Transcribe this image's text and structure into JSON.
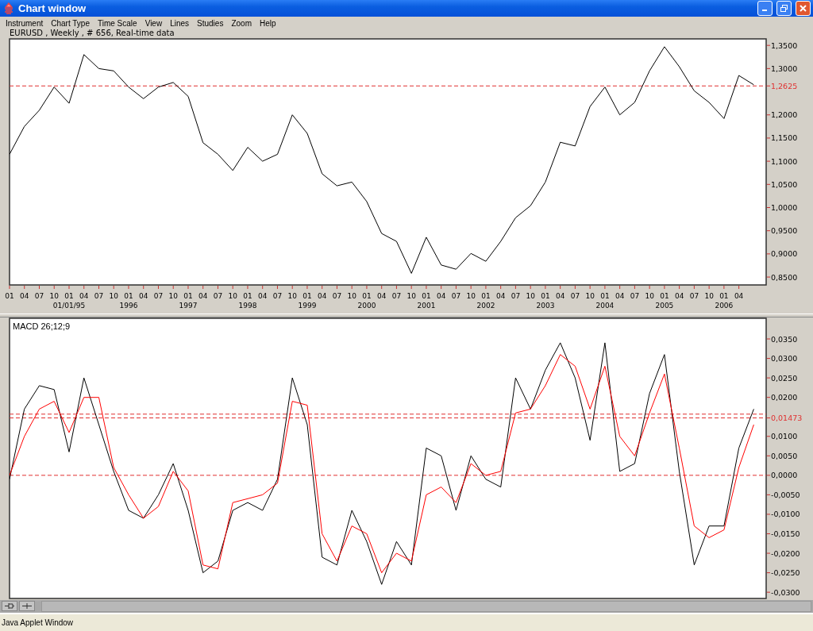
{
  "window": {
    "title": "Chart window"
  },
  "menu": [
    "Instrument",
    "Chart Type",
    "Time Scale",
    "View",
    "Lines",
    "Studies",
    "Zoom",
    "Help"
  ],
  "info_line": "EURUSD , Weekly , # 656, Real-time data",
  "price_chart": {
    "chart_data": {
      "type": "line",
      "categories": [
        "01",
        "04",
        "07",
        "10",
        "01",
        "04",
        "07",
        "10",
        "01",
        "04",
        "07",
        "10",
        "01",
        "04",
        "07",
        "10",
        "01",
        "04",
        "07",
        "10",
        "01",
        "04",
        "07",
        "10",
        "01",
        "04",
        "07",
        "10",
        "01",
        "04",
        "07",
        "10",
        "01",
        "04",
        "07",
        "10",
        "01",
        "04",
        "07",
        "10",
        "01",
        "04",
        "07",
        "10",
        "01",
        "04",
        "07",
        "10",
        "01",
        "04",
        null
      ],
      "series": [
        {
          "color": "#000000",
          "values": [
            1.115,
            1.175,
            1.21,
            1.26,
            1.225,
            1.33,
            1.3,
            1.295,
            1.26,
            1.235,
            1.26,
            1.27,
            1.24,
            1.14,
            1.115,
            1.08,
            1.13,
            1.1,
            1.115,
            1.2,
            1.16,
            1.073,
            1.047,
            1.055,
            1.013,
            0.944,
            0.927,
            0.858,
            0.936,
            0.876,
            0.867,
            0.901,
            0.884,
            0.927,
            0.978,
            1.004,
            1.055,
            1.141,
            1.133,
            1.218,
            1.26,
            1.2,
            1.227,
            1.295,
            1.347,
            1.304,
            1.252,
            1.227,
            1.192,
            1.285,
            1.265
          ]
        }
      ],
      "ylim": [
        0.833,
        1.364
      ],
      "yticks": [
        {
          "value": 1.35,
          "label": "1,3500"
        },
        {
          "value": 1.3,
          "label": "1,3000"
        },
        {
          "value": 1.2,
          "label": "1,2000"
        },
        {
          "value": 1.15,
          "label": "1,1500"
        },
        {
          "value": 1.1,
          "label": "1,1000"
        },
        {
          "value": 1.05,
          "label": "1,0500"
        },
        {
          "value": 1.0,
          "label": "1,0000"
        },
        {
          "value": 0.95,
          "label": "0,9500"
        },
        {
          "value": 0.9,
          "label": "0,9000"
        },
        {
          "value": 0.85,
          "label": "0,8500"
        }
      ],
      "ref_lines": [
        {
          "axis": "y",
          "value": 1.2625,
          "label": "1,2625",
          "color": "#e03030"
        }
      ]
    },
    "year_labels": [
      "01/01/95",
      "1996",
      "1997",
      "1998",
      "1999",
      "2000",
      "2001",
      "2002",
      "2003",
      "2004",
      "2005",
      "2006"
    ]
  },
  "macd_chart": {
    "chart_data": {
      "type": "line",
      "title": "MACD 26;12;9",
      "categories": [
        null,
        null,
        null,
        null,
        null,
        null,
        null,
        null,
        null,
        null,
        null,
        null,
        null,
        null,
        null,
        null,
        null,
        null,
        null,
        null,
        null,
        null,
        null,
        null,
        null,
        null,
        null,
        null,
        null,
        null,
        null,
        null,
        null,
        null,
        null,
        null,
        null,
        null,
        null,
        null,
        null,
        null,
        null,
        null,
        null,
        null,
        null,
        null,
        null,
        null,
        null
      ],
      "series": [
        {
          "color": "#000000",
          "values": [
            -0.001,
            0.017,
            0.023,
            0.022,
            0.006,
            0.025,
            0.013,
            0.001,
            -0.009,
            -0.011,
            -0.005,
            0.003,
            -0.009,
            -0.025,
            -0.022,
            -0.009,
            -0.007,
            -0.009,
            -0.001,
            0.025,
            0.013,
            -0.021,
            -0.023,
            -0.009,
            -0.017,
            -0.028,
            -0.017,
            -0.023,
            0.007,
            0.005,
            -0.009,
            0.005,
            -0.001,
            -0.003,
            0.025,
            0.017,
            0.027,
            0.034,
            0.025,
            0.009,
            0.034,
            0.001,
            0.003,
            0.021,
            0.031,
            0.001,
            -0.023,
            -0.013,
            -0.013,
            0.007,
            0.017
          ]
        },
        {
          "color": "#ff0000",
          "values": [
            0.0,
            0.01,
            0.017,
            0.019,
            0.011,
            0.02,
            0.02,
            0.002,
            -0.005,
            -0.011,
            -0.008,
            0.001,
            -0.004,
            -0.023,
            -0.024,
            -0.007,
            -0.006,
            -0.005,
            -0.002,
            0.019,
            0.018,
            -0.015,
            -0.022,
            -0.013,
            -0.015,
            -0.025,
            -0.02,
            -0.022,
            -0.005,
            -0.003,
            -0.007,
            0.003,
            0.0,
            0.001,
            0.016,
            0.017,
            0.023,
            0.031,
            0.028,
            0.017,
            0.028,
            0.01,
            0.005,
            0.016,
            0.026,
            0.007,
            -0.013,
            -0.016,
            -0.014,
            0.002,
            0.013
          ]
        }
      ],
      "ylim": [
        -0.0316,
        0.0403
      ],
      "yticks": [
        {
          "value": 0.035,
          "label": "0,0350"
        },
        {
          "value": 0.03,
          "label": "0,0300"
        },
        {
          "value": 0.025,
          "label": "0,0250"
        },
        {
          "value": 0.02,
          "label": "0,0200"
        },
        {
          "value": 0.01,
          "label": "0,0100"
        },
        {
          "value": 0.005,
          "label": "0,0050"
        },
        {
          "value": 0,
          "label": "0,0000"
        },
        {
          "value": -0.005,
          "label": "-0,0050"
        },
        {
          "value": -0.01,
          "label": "-0,0100"
        },
        {
          "value": -0.015,
          "label": "-0,0150"
        },
        {
          "value": -0.02,
          "label": "-0,0200"
        },
        {
          "value": -0.025,
          "label": "-0,0250"
        },
        {
          "value": -0.03,
          "label": "-0,0300"
        }
      ],
      "ref_lines": [
        {
          "axis": "y",
          "value": 0.0157,
          "color": "#e03030"
        },
        {
          "axis": "y",
          "value": 0.01473,
          "label": "0,01473",
          "color": "#e03030"
        },
        {
          "axis": "y",
          "value": 0,
          "color": "#e03030"
        }
      ]
    }
  },
  "status_bar": "Java Applet Window"
}
